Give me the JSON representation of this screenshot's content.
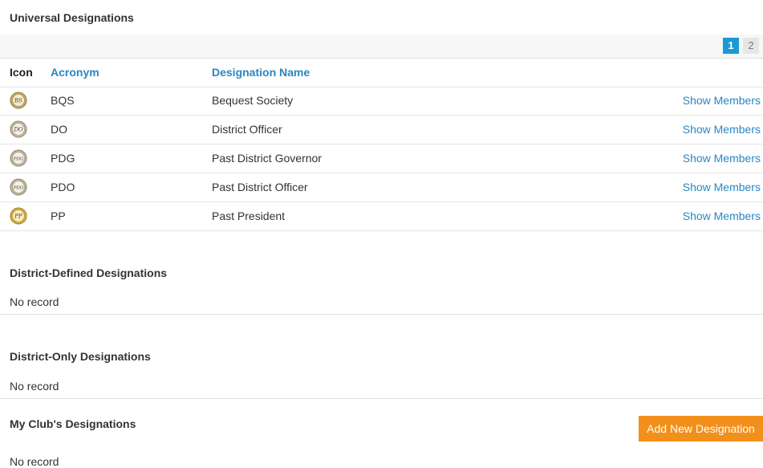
{
  "universal": {
    "title": "Universal Designations",
    "pages": [
      "1",
      "2"
    ],
    "columns": {
      "icon": "Icon",
      "acronym": "Acronym",
      "name": "Designation Name"
    },
    "rows": [
      {
        "acronym": "BQS",
        "name": "Bequest Society",
        "link": "Show Members",
        "icon": "bequest-society-badge-icon",
        "monogram": "BS"
      },
      {
        "acronym": "DO",
        "name": "District Officer",
        "link": "Show Members",
        "icon": "district-officer-badge-icon",
        "monogram": "DO"
      },
      {
        "acronym": "PDG",
        "name": "Past District Governor",
        "link": "Show Members",
        "icon": "past-district-governor-badge-icon",
        "monogram": "PDG"
      },
      {
        "acronym": "PDO",
        "name": "Past District Officer",
        "link": "Show Members",
        "icon": "past-district-officer-badge-icon",
        "monogram": "PDO"
      },
      {
        "acronym": "PP",
        "name": "Past President",
        "link": "Show Members",
        "icon": "past-president-badge-icon",
        "monogram": "PP"
      }
    ]
  },
  "district_defined": {
    "title": "District-Defined Designations",
    "empty": "No record"
  },
  "district_only": {
    "title": "District-Only Designations",
    "empty": "No record"
  },
  "my_club": {
    "title": "My Club's Designations",
    "add_button": "Add New Designation",
    "empty": "No record"
  },
  "colors": {
    "link": "#2a87c0",
    "page_active": "#1a99d6",
    "add_button": "#f2901b"
  }
}
